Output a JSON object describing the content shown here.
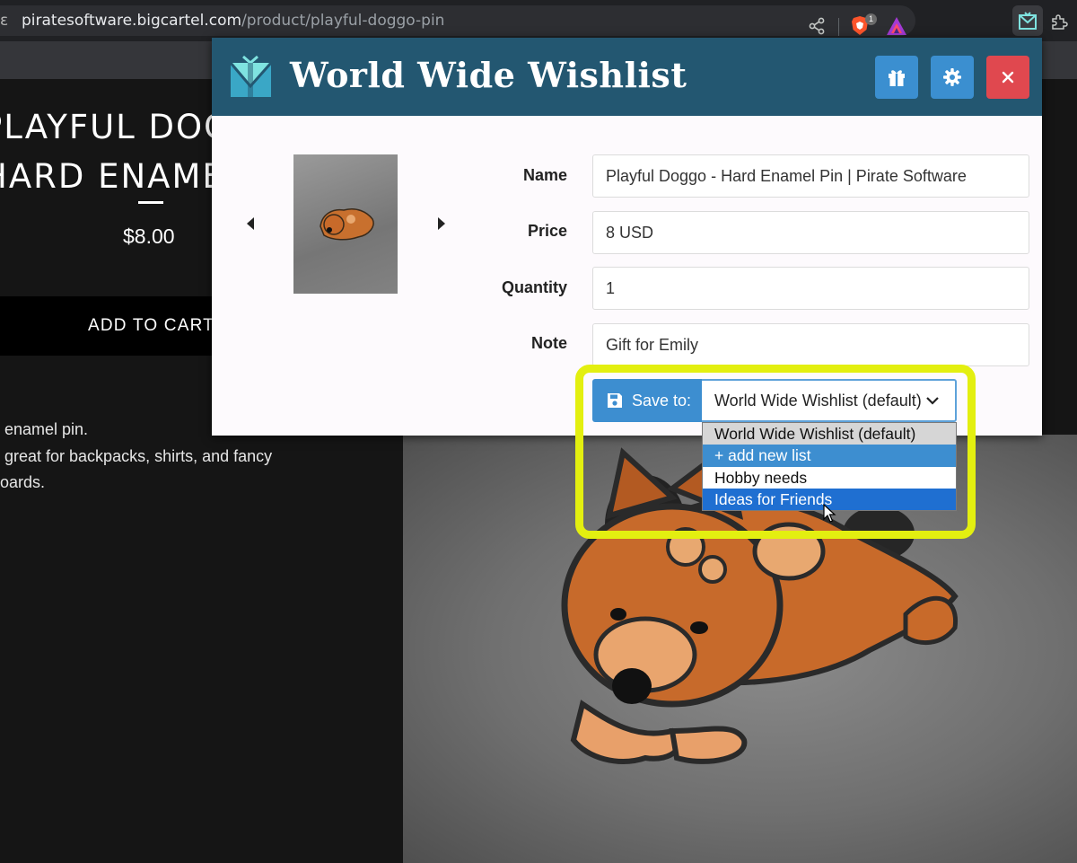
{
  "browser": {
    "url_prefix": "ε",
    "url_host": "piratesoftware.bigcartel.com",
    "url_path": "/product/playful-doggo-pin",
    "shield_badge_count": "1",
    "icons": [
      "share-icon",
      "brave-shields-icon",
      "brave-rewards-icon",
      "wishlist-extension-icon",
      "puzzle-icon"
    ]
  },
  "store": {
    "title_line1": "PLAYFUL DOGGO",
    "title_line2": "HARD ENAMEL",
    "price": "$8.00",
    "add_to_cart": "ADD TO CART",
    "description": " enamel pin.\n great for backpacks, shirts, and fancy\noards."
  },
  "popup": {
    "title": "World Wide Wishlist",
    "header_buttons": [
      "gift-icon",
      "gear-icon",
      "close-icon"
    ],
    "colors": {
      "header": "#235771",
      "primary": "#3d8ed0",
      "danger": "#e0484f",
      "highlight": "#e3ef10"
    },
    "fields": {
      "name_label": "Name",
      "name_value": "Playful Doggo - Hard Enamel Pin | Pirate Software",
      "price_label": "Price",
      "price_value": "8 USD",
      "quantity_label": "Quantity",
      "quantity_value": "1",
      "note_label": "Note",
      "note_value": "Gift for Emily"
    },
    "save_label": "Save to:",
    "selected_list": "World Wide Wishlist (default)",
    "list_options": [
      "World Wide Wishlist (default)",
      "+ add new list",
      "Hobby needs",
      "Ideas for Friends"
    ]
  }
}
